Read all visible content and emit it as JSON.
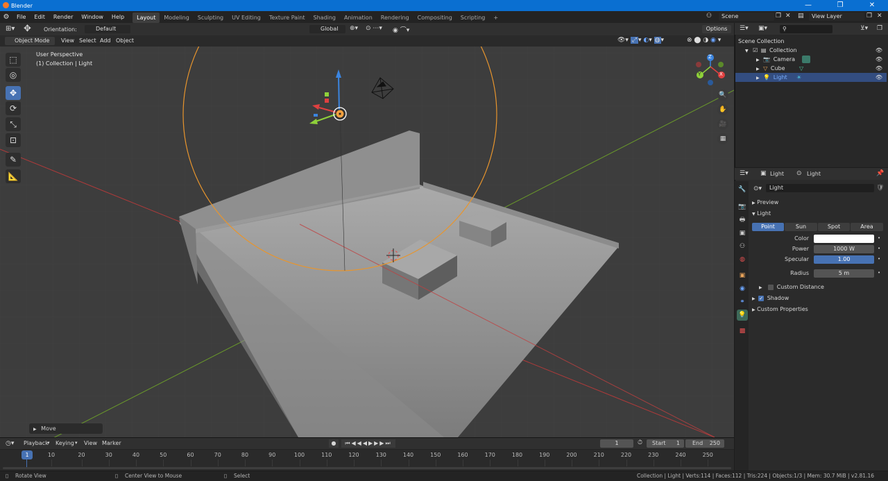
{
  "window": {
    "title": "Blender"
  },
  "menu": [
    "File",
    "Edit",
    "Render",
    "Window",
    "Help"
  ],
  "workspaces": [
    {
      "label": "Layout",
      "active": true
    },
    {
      "label": "Modeling"
    },
    {
      "label": "Sculpting"
    },
    {
      "label": "UV Editing"
    },
    {
      "label": "Texture Paint"
    },
    {
      "label": "Shading"
    },
    {
      "label": "Animation"
    },
    {
      "label": "Rendering"
    },
    {
      "label": "Compositing"
    },
    {
      "label": "Scripting"
    }
  ],
  "add_workspace": "+",
  "scene_selector": {
    "scene": "Scene",
    "view_layer": "View Layer"
  },
  "viewport_header": {
    "orientation_label": "Orientation:",
    "orientation_value": "Default",
    "transform_space": "Global",
    "options": "Options",
    "mode": "Object Mode",
    "menus": [
      "View",
      "Select",
      "Add",
      "Object"
    ]
  },
  "viewport": {
    "perspective": "User Perspective",
    "context": "(1) Collection | Light",
    "last_op": "Move",
    "gizmo_axes": {
      "x": "X",
      "y": "Y",
      "z": "Z"
    }
  },
  "outliner": {
    "root": "Scene Collection",
    "collection": "Collection",
    "items": [
      {
        "name": "Camera",
        "selected": false,
        "color": "#e8a35a"
      },
      {
        "name": "Cube",
        "selected": false,
        "color": "#e8a35a"
      },
      {
        "name": "Light",
        "selected": true,
        "color": "#e8a35a"
      }
    ]
  },
  "properties": {
    "breadcrumb_object": "Light",
    "breadcrumb_data": "Light",
    "datablock": "Light",
    "sections": {
      "preview": "Preview",
      "light": "Light",
      "custom_distance": "Custom Distance",
      "shadow": "Shadow",
      "custom_props": "Custom Properties"
    },
    "light_types": [
      {
        "label": "Point",
        "active": true
      },
      {
        "label": "Sun"
      },
      {
        "label": "Spot"
      },
      {
        "label": "Area"
      }
    ],
    "fields": {
      "color_label": "Color",
      "power_label": "Power",
      "power_value": "1000 W",
      "specular_label": "Specular",
      "specular_value": "1.00",
      "radius_label": "Radius",
      "radius_value": "5 m"
    },
    "shadow_checked": true,
    "custom_distance_checked": false
  },
  "timeline": {
    "menus": [
      "Playback",
      "Keying",
      "View",
      "Marker"
    ],
    "current_frame": "1",
    "start_label": "Start",
    "start_value": "1",
    "end_label": "End",
    "end_value": "250",
    "ruler": [
      "1",
      "10",
      "20",
      "30",
      "40",
      "50",
      "60",
      "70",
      "80",
      "90",
      "100",
      "110",
      "120",
      "130",
      "140",
      "150",
      "160",
      "170",
      "180",
      "190",
      "200",
      "210",
      "220",
      "230",
      "240",
      "250"
    ]
  },
  "statusbar": {
    "left1": "Rotate View",
    "left2": "Center View to Mouse",
    "left3": "Select",
    "right": "Collection | Light | Verts:114 | Faces:112 | Tris:224 | Objects:1/3 | Mem: 30.7 MiB | v2.81.16"
  },
  "colors": {
    "accent": "#4772b3",
    "titlebar": "#0a6fd1",
    "light_orange": "#f0a040"
  }
}
